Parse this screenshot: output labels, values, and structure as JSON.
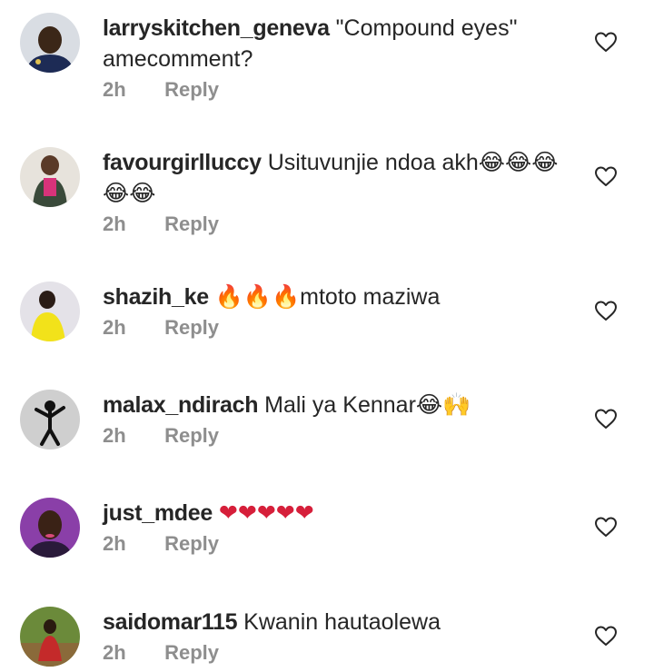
{
  "icons": {
    "like": "heart-outline-icon"
  },
  "colors": {
    "meta": "#8e8e8e",
    "text": "#262626",
    "heart": "#262626"
  },
  "comments": [
    {
      "username": "larryskitchen_geneva",
      "text": "\"Compound eyes\" amecomment?",
      "time": "2h",
      "reply": "Reply"
    },
    {
      "username": "favourgirlluccy",
      "text": "Usituvunjie ndoa akh😂😂😂😂😂",
      "time": "2h",
      "reply": "Reply"
    },
    {
      "username": "shazih_ke",
      "text": "🔥🔥🔥mtoto maziwa",
      "time": "2h",
      "reply": "Reply"
    },
    {
      "username": "malax_ndirach",
      "text": "Mali ya Kennar😂🙌",
      "time": "2h",
      "reply": "Reply"
    },
    {
      "username": "just_mdee",
      "text": "❤❤❤❤❤",
      "time": "2h",
      "reply": "Reply"
    },
    {
      "username": "saidomar115",
      "text": "Kwanin hautaolewa",
      "time": "2h",
      "reply": "Reply"
    }
  ]
}
